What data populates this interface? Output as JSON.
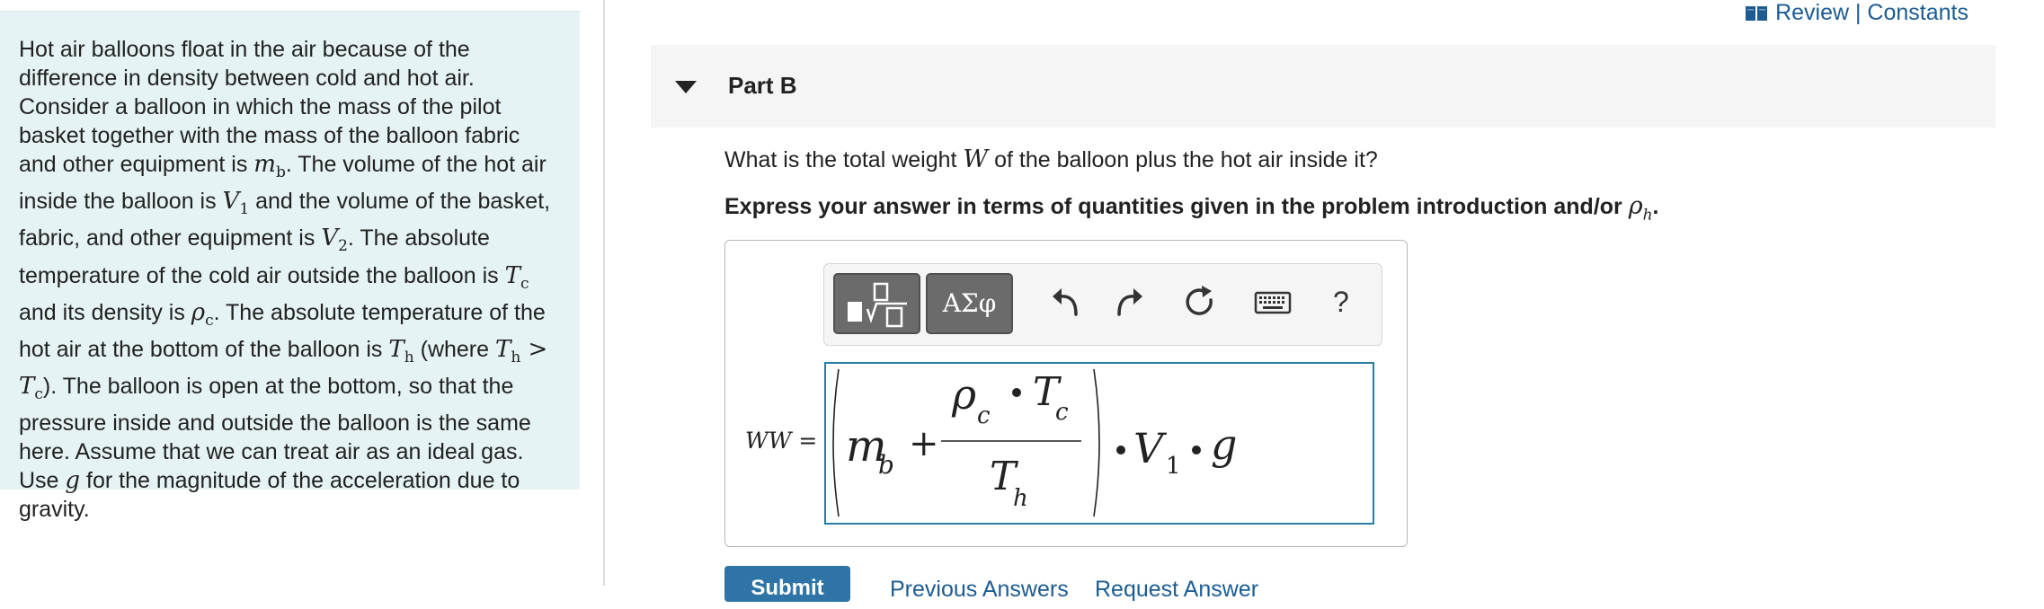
{
  "problem": {
    "p1": "Hot air balloons float in the air because of the difference in density between cold and hot air. Consider a balloon in which the mass of the pilot basket together with the mass of the balloon fabric and other equipment is ",
    "mb_sym": "m",
    "mb_sub": "b",
    "p2": ". The volume of the hot air inside the balloon is ",
    "v1_sym": "V",
    "v1_sub": "1",
    "p3": " and the volume of the basket, fabric, and other equipment is ",
    "v2_sym": "V",
    "v2_sub": "2",
    "p4": ". The absolute temperature of the cold air outside the balloon is ",
    "tc_sym": "T",
    "tc_sub": "c",
    "p5": " and its density is ",
    "rc_sym": "ρ",
    "rc_sub": "c",
    "p6": ". The absolute temperature of the hot air at the bottom of the balloon is ",
    "th_sym": "T",
    "th_sub": "h",
    "p7": " (where ",
    "th2_sym": "T",
    "th2_sub": "h",
    "gt": " > ",
    "tc2_sym": "T",
    "tc2_sub": "c",
    "p8": "). The balloon is open at the bottom, so that the pressure inside and outside the balloon is the same here. Assume that we can treat air as an ideal gas. Use ",
    "g_sym": "g",
    "p9": " for the magnitude of the acceleration due to gravity."
  },
  "header": {
    "review_link": "Review | Constants"
  },
  "part": {
    "title": "Part B"
  },
  "question": {
    "q1": "What is the total weight ",
    "w_sym": "W",
    "q2": " of the balloon plus the hot air inside it?"
  },
  "instruction": {
    "text": "Express your answer in terms of quantities given in the problem introduction and/or ",
    "rho_sym": "ρ",
    "rho_sub": "h",
    "end": "."
  },
  "toolbar": {
    "symbols_label": "ΑΣφ",
    "help_label": "?"
  },
  "answer": {
    "var_label": "WW",
    "equals": " =",
    "m_sym": "m",
    "m_sub": "b",
    "plus": "+",
    "num_rho": "ρ",
    "num_rho_sub": "c",
    "num_T": "T",
    "num_T_sub": "c",
    "den_T": "T",
    "den_T_sub": "h",
    "v_sym": "V",
    "v_sub": "1",
    "g_sym": "g"
  },
  "actions": {
    "submit_label": "Submit",
    "previous_label": "Previous Answers",
    "request_label": "Request Answer"
  }
}
